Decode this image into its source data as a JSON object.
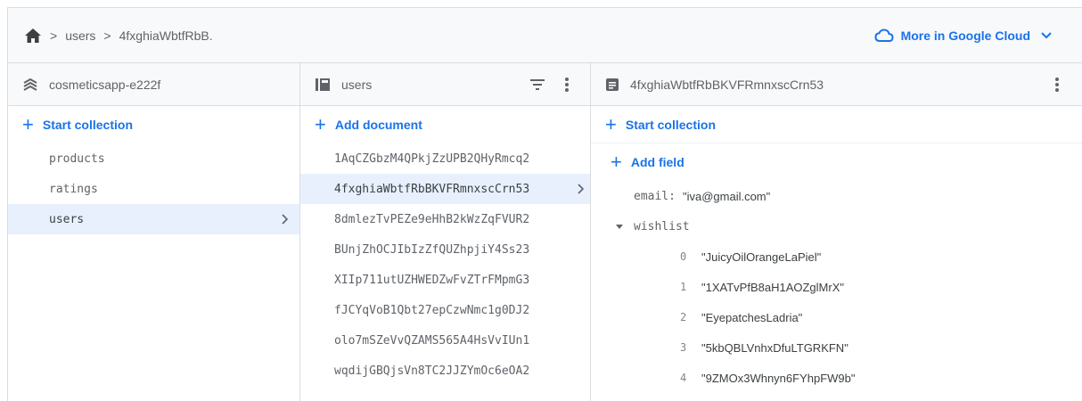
{
  "breadcrumb": {
    "items": [
      "users",
      "4fxghiaWbtfRbB."
    ]
  },
  "header": {
    "more_label": "More in Google Cloud"
  },
  "columns": {
    "root": {
      "title": "cosmeticsapp-e222f",
      "add_label": "Start collection",
      "items": [
        "products",
        "ratings",
        "users"
      ],
      "selected": "users"
    },
    "collection": {
      "title": "users",
      "add_label": "Add document",
      "items": [
        "1AqCZGbzM4QPkjZzUPB2QHyRmcq2",
        "4fxghiaWbtfRbBKVFRmnxscCrn53",
        "8dmlezTvPEZe9eHhB2kWzZqFVUR2",
        "BUnjZhOCJIbIzZfQUZhpjiY4Ss23",
        "XIIp711utUZHWEDZwFvZTrFMpmG3",
        "fJCYqVoB1Qbt27epCzwNmc1g0DJ2",
        "olo7mSZeVvQZAMS565A4HsVvIUn1",
        "wqdijGBQjsVn8TC2JJZYmOc6eOA2"
      ],
      "selected": "4fxghiaWbtfRbBKVFRmnxscCrn53"
    },
    "document": {
      "title": "4fxghiaWbtfRbBKVFRmnxscCrn53",
      "start_collection_label": "Start collection",
      "add_field_label": "Add field",
      "fields": {
        "email": {
          "key": "email:",
          "value": "\"iva@gmail.com\""
        },
        "wishlist": {
          "key": "wishlist",
          "items": [
            {
              "index": "0",
              "value": "\"JuicyOilOrangeLaPiel\""
            },
            {
              "index": "1",
              "value": "\"1XATvPfB8aH1AOZglMrX\""
            },
            {
              "index": "2",
              "value": "\"EyepatchesLadria\""
            },
            {
              "index": "3",
              "value": "\"5kbQBLVnhxDfuLTGRKFN\""
            },
            {
              "index": "4",
              "value": "\"9ZMOx3Whnyn6FYhpFW9b\""
            }
          ]
        }
      }
    }
  },
  "colors": {
    "accent": "#1a73e8",
    "selected_bg": "#e8f0fe",
    "header_bg": "#f8f9fa",
    "border": "#dadce0"
  },
  "icons": {
    "home": "home-icon",
    "cloud": "cloud-icon",
    "project": "database-icon",
    "collection": "collection-icon",
    "document": "document-icon",
    "filter": "filter-icon",
    "more": "more-vert-icon"
  }
}
